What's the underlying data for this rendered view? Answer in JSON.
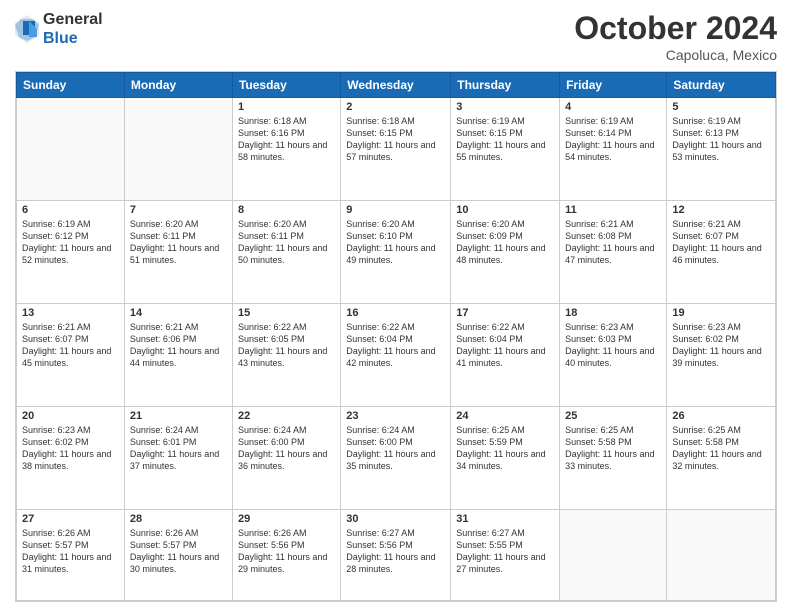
{
  "header": {
    "logo_general": "General",
    "logo_blue": "Blue",
    "month_title": "October 2024",
    "location": "Capoluca, Mexico"
  },
  "days_of_week": [
    "Sunday",
    "Monday",
    "Tuesday",
    "Wednesday",
    "Thursday",
    "Friday",
    "Saturday"
  ],
  "weeks": [
    [
      {
        "date": "",
        "info": ""
      },
      {
        "date": "",
        "info": ""
      },
      {
        "date": "1",
        "info": "Sunrise: 6:18 AM\nSunset: 6:16 PM\nDaylight: 11 hours and 58 minutes."
      },
      {
        "date": "2",
        "info": "Sunrise: 6:18 AM\nSunset: 6:15 PM\nDaylight: 11 hours and 57 minutes."
      },
      {
        "date": "3",
        "info": "Sunrise: 6:19 AM\nSunset: 6:15 PM\nDaylight: 11 hours and 55 minutes."
      },
      {
        "date": "4",
        "info": "Sunrise: 6:19 AM\nSunset: 6:14 PM\nDaylight: 11 hours and 54 minutes."
      },
      {
        "date": "5",
        "info": "Sunrise: 6:19 AM\nSunset: 6:13 PM\nDaylight: 11 hours and 53 minutes."
      }
    ],
    [
      {
        "date": "6",
        "info": "Sunrise: 6:19 AM\nSunset: 6:12 PM\nDaylight: 11 hours and 52 minutes."
      },
      {
        "date": "7",
        "info": "Sunrise: 6:20 AM\nSunset: 6:11 PM\nDaylight: 11 hours and 51 minutes."
      },
      {
        "date": "8",
        "info": "Sunrise: 6:20 AM\nSunset: 6:11 PM\nDaylight: 11 hours and 50 minutes."
      },
      {
        "date": "9",
        "info": "Sunrise: 6:20 AM\nSunset: 6:10 PM\nDaylight: 11 hours and 49 minutes."
      },
      {
        "date": "10",
        "info": "Sunrise: 6:20 AM\nSunset: 6:09 PM\nDaylight: 11 hours and 48 minutes."
      },
      {
        "date": "11",
        "info": "Sunrise: 6:21 AM\nSunset: 6:08 PM\nDaylight: 11 hours and 47 minutes."
      },
      {
        "date": "12",
        "info": "Sunrise: 6:21 AM\nSunset: 6:07 PM\nDaylight: 11 hours and 46 minutes."
      }
    ],
    [
      {
        "date": "13",
        "info": "Sunrise: 6:21 AM\nSunset: 6:07 PM\nDaylight: 11 hours and 45 minutes."
      },
      {
        "date": "14",
        "info": "Sunrise: 6:21 AM\nSunset: 6:06 PM\nDaylight: 11 hours and 44 minutes."
      },
      {
        "date": "15",
        "info": "Sunrise: 6:22 AM\nSunset: 6:05 PM\nDaylight: 11 hours and 43 minutes."
      },
      {
        "date": "16",
        "info": "Sunrise: 6:22 AM\nSunset: 6:04 PM\nDaylight: 11 hours and 42 minutes."
      },
      {
        "date": "17",
        "info": "Sunrise: 6:22 AM\nSunset: 6:04 PM\nDaylight: 11 hours and 41 minutes."
      },
      {
        "date": "18",
        "info": "Sunrise: 6:23 AM\nSunset: 6:03 PM\nDaylight: 11 hours and 40 minutes."
      },
      {
        "date": "19",
        "info": "Sunrise: 6:23 AM\nSunset: 6:02 PM\nDaylight: 11 hours and 39 minutes."
      }
    ],
    [
      {
        "date": "20",
        "info": "Sunrise: 6:23 AM\nSunset: 6:02 PM\nDaylight: 11 hours and 38 minutes."
      },
      {
        "date": "21",
        "info": "Sunrise: 6:24 AM\nSunset: 6:01 PM\nDaylight: 11 hours and 37 minutes."
      },
      {
        "date": "22",
        "info": "Sunrise: 6:24 AM\nSunset: 6:00 PM\nDaylight: 11 hours and 36 minutes."
      },
      {
        "date": "23",
        "info": "Sunrise: 6:24 AM\nSunset: 6:00 PM\nDaylight: 11 hours and 35 minutes."
      },
      {
        "date": "24",
        "info": "Sunrise: 6:25 AM\nSunset: 5:59 PM\nDaylight: 11 hours and 34 minutes."
      },
      {
        "date": "25",
        "info": "Sunrise: 6:25 AM\nSunset: 5:58 PM\nDaylight: 11 hours and 33 minutes."
      },
      {
        "date": "26",
        "info": "Sunrise: 6:25 AM\nSunset: 5:58 PM\nDaylight: 11 hours and 32 minutes."
      }
    ],
    [
      {
        "date": "27",
        "info": "Sunrise: 6:26 AM\nSunset: 5:57 PM\nDaylight: 11 hours and 31 minutes."
      },
      {
        "date": "28",
        "info": "Sunrise: 6:26 AM\nSunset: 5:57 PM\nDaylight: 11 hours and 30 minutes."
      },
      {
        "date": "29",
        "info": "Sunrise: 6:26 AM\nSunset: 5:56 PM\nDaylight: 11 hours and 29 minutes."
      },
      {
        "date": "30",
        "info": "Sunrise: 6:27 AM\nSunset: 5:56 PM\nDaylight: 11 hours and 28 minutes."
      },
      {
        "date": "31",
        "info": "Sunrise: 6:27 AM\nSunset: 5:55 PM\nDaylight: 11 hours and 27 minutes."
      },
      {
        "date": "",
        "info": ""
      },
      {
        "date": "",
        "info": ""
      }
    ]
  ]
}
